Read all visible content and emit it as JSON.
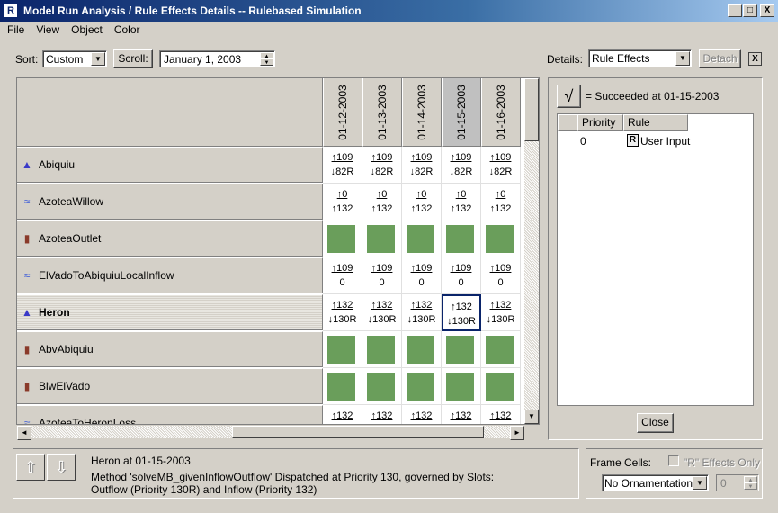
{
  "window": {
    "title": "Model Run Analysis / Rule Effects Details -- Rulebased Simulation",
    "icon": "R",
    "minimize": "_",
    "maximize": "□",
    "close": "X"
  },
  "menu": [
    "File",
    "View",
    "Object",
    "Color"
  ],
  "toolbar": {
    "sort_label": "Sort:",
    "sort_value": "Custom",
    "scroll_button": "Scroll:",
    "date_value": "January 1, 2003",
    "details_label": "Details:",
    "details_value": "Rule Effects",
    "detach_button": "Detach",
    "close_x": "X"
  },
  "grid": {
    "columns": [
      "01-12-2003",
      "01-13-2003",
      "01-14-2003",
      "01-15-2003",
      "01-16-2003"
    ],
    "rows": [
      {
        "name": "Abiquiu",
        "icon": "reservoir-icon",
        "cells": [
          [
            "↑109",
            "↓82R"
          ],
          [
            "↑109",
            "↓82R"
          ],
          [
            "↑109",
            "↓82R"
          ],
          [
            "↑109",
            "↓82R"
          ],
          [
            "↑109",
            "↓82R"
          ]
        ]
      },
      {
        "name": "AzoteaWillow",
        "icon": "reach-icon",
        "cells": [
          [
            "↑0",
            "↑132"
          ],
          [
            "↑0",
            "↑132"
          ],
          [
            "↑0",
            "↑132"
          ],
          [
            "↑0",
            "↑132"
          ],
          [
            "↑0",
            "↑132"
          ]
        ]
      },
      {
        "name": "AzoteaOutlet",
        "icon": "outlet-icon",
        "cells": "green"
      },
      {
        "name": "ElVadoToAbiquiuLocalInflow",
        "icon": "reach-icon",
        "cells": [
          [
            "↑109",
            "0"
          ],
          [
            "↑109",
            "0"
          ],
          [
            "↑109",
            "0"
          ],
          [
            "↑109",
            "0"
          ],
          [
            "↑109",
            "0"
          ]
        ]
      },
      {
        "name": "Heron",
        "icon": "reservoir-icon",
        "cells": [
          [
            "↑132",
            "↓130R"
          ],
          [
            "↑132",
            "↓130R"
          ],
          [
            "↑132",
            "↓130R"
          ],
          [
            "↑132",
            "↓130R"
          ],
          [
            "↑132",
            "↓130R"
          ]
        ]
      },
      {
        "name": "AbvAbiquiu",
        "icon": "outlet-icon",
        "cells": "green"
      },
      {
        "name": "BlwElVado",
        "icon": "outlet-icon",
        "cells": "green"
      },
      {
        "name": "AzoteaToHeronLoss",
        "icon": "reach-icon",
        "cells": [
          [
            "↑132",
            ""
          ],
          [
            "↑132",
            ""
          ],
          [
            "↑132",
            ""
          ],
          [
            "↑132",
            ""
          ],
          [
            "↑132",
            ""
          ]
        ]
      }
    ],
    "selected_row": 4,
    "selected_col": 3,
    "cell_color": "#6a9e5b"
  },
  "details": {
    "check": "√",
    "succeeded_text": "= Succeeded at 01-15-2003",
    "columns": [
      "Priority",
      "Rule"
    ],
    "rows": [
      {
        "priority": "0",
        "rule_icon": "R",
        "rule": "User Input"
      }
    ],
    "close_button": "Close"
  },
  "status": {
    "title": "Heron at 01-15-2003",
    "line1": "Method 'solveMB_givenInflowOutflow' Dispatched at Priority 130, governed by Slots:",
    "line2": "Outflow (Priority 130R) and Inflow (Priority 132)"
  },
  "frame": {
    "label": "Frame Cells:",
    "r_effects_label": "\"R\" Effects Only",
    "ornament_value": "No Ornamentation",
    "spin_value": "0"
  }
}
